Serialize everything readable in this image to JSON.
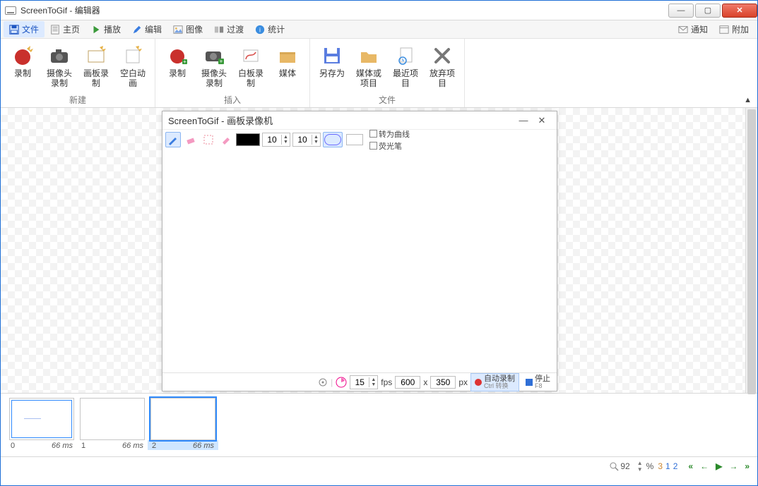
{
  "window": {
    "title": "ScreenToGif - 编辑器"
  },
  "menu": {
    "file": "文件",
    "home": "主页",
    "play": "播放",
    "edit": "编辑",
    "image": "图像",
    "transition": "过渡",
    "stats": "统计",
    "notify": "通知",
    "attach": "附加"
  },
  "ribbon": {
    "new": {
      "name": "新建",
      "record": "录制",
      "webcam": "摄像头录制",
      "board": "画板录制",
      "blank": "空白动画"
    },
    "insert": {
      "name": "插入",
      "record": "录制",
      "webcam": "摄像头录制",
      "whiteboard": "白板录制",
      "media": "媒体"
    },
    "file": {
      "name": "文件",
      "saveas": "另存为",
      "mediaproj": "媒体或项目",
      "recent": "最近项目",
      "discard": "放弃项目"
    }
  },
  "board": {
    "title": "ScreenToGif - 画板录像机",
    "size1": "10",
    "size2": "10",
    "curve": "转为曲线",
    "highlighter": "荧光笔",
    "fps_val": "15",
    "fps_lbl": "fps",
    "w": "600",
    "h": "350",
    "px": "px",
    "x": "x",
    "autorec": "自动录制",
    "autorec_sub": "Ctrl 转换",
    "stop": "停止",
    "stop_sub": "F8"
  },
  "frames": {
    "items": [
      {
        "idx": "0",
        "ms": "66 ms"
      },
      {
        "idx": "1",
        "ms": "66 ms"
      },
      {
        "idx": "2",
        "ms": "66 ms"
      }
    ]
  },
  "status": {
    "zoom": "92",
    "pct": "%",
    "n1": "3",
    "n2": "1",
    "n3": "2"
  }
}
